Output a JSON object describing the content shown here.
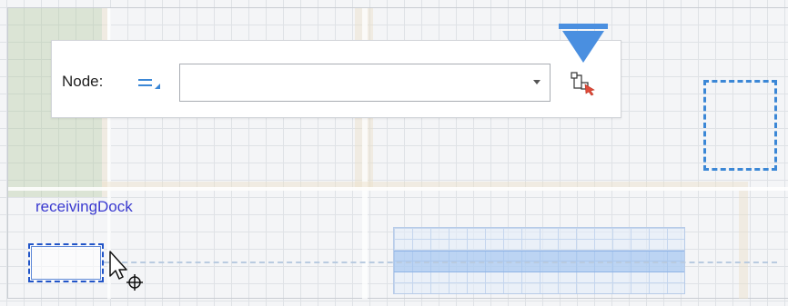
{
  "node_panel": {
    "label": "Node:",
    "combo_value": "",
    "list_icon": "list-options-icon",
    "select_button_icon": "select-node-icon"
  },
  "canvas": {
    "receiving_dock_label": "receivingDock",
    "drop_indicator_icon": "drop-arrow-icon",
    "cursor_icon": "move-cursor-icon"
  },
  "colors": {
    "accent": "#3b87d6",
    "drop_arrow": "#4a8fe0",
    "receiving_label": "#3a3ad0",
    "conveyor_band": "#96beee",
    "green_zone": "#adc594"
  }
}
